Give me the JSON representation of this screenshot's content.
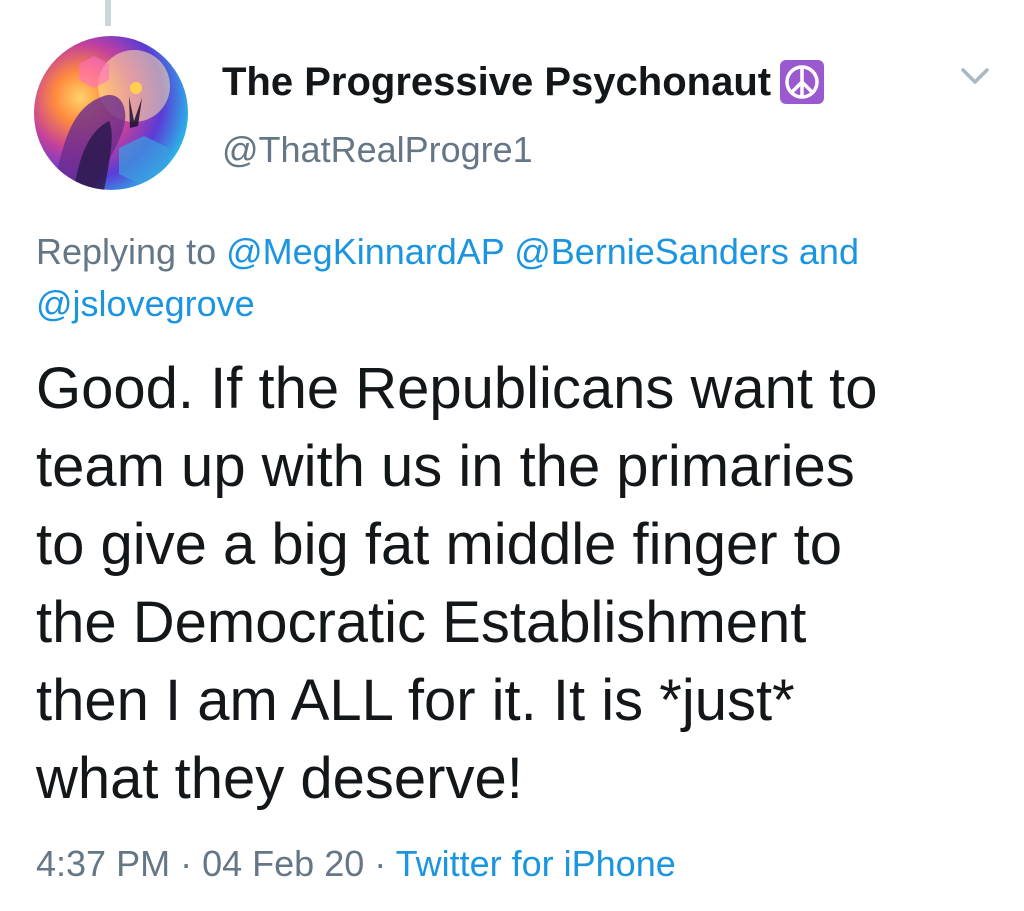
{
  "tweet": {
    "author": {
      "display_name": "The Progressive Psychonaut",
      "badge_icon": "peace-sign-icon",
      "handle": "@ThatRealProgre1"
    },
    "reply": {
      "prefix": "Replying to",
      "mentions": [
        "@MegKinnardAP",
        "@BernieSanders",
        "@jslovegrove"
      ],
      "joiner": "and"
    },
    "text_lines": [
      "Good. If the Republicans want to",
      "team up with us in the primaries",
      "to give a big fat middle finger to",
      "the Democratic Establishment",
      "then I am ALL for it. It is *just*",
      "what they deserve!"
    ],
    "meta": {
      "time": "4:37 PM",
      "date": "04 Feb 20",
      "separator": "·",
      "source": "Twitter for iPhone"
    }
  },
  "colors": {
    "text": "#14171a",
    "secondary": "#657786",
    "link": "#1b95e0",
    "badge": "#9b59d0"
  }
}
